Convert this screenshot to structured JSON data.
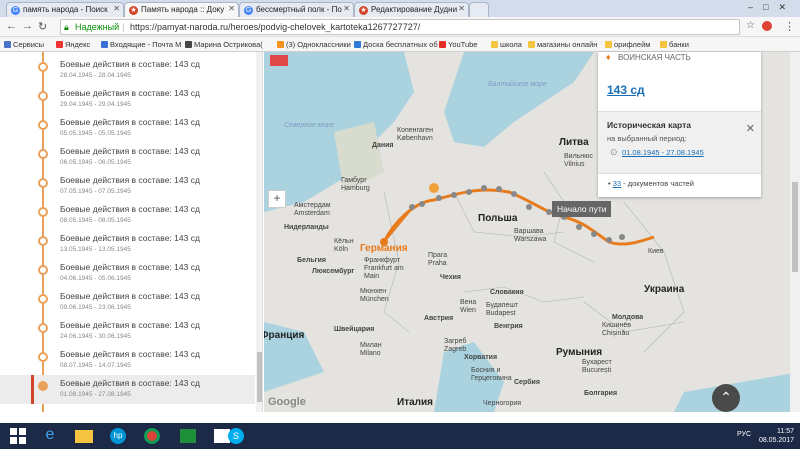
{
  "tabs": [
    {
      "label": "память народа - Поиск",
      "fav_color": "#4285f4",
      "fav_glyph": "G"
    },
    {
      "label": "Память народа :: Доку",
      "fav_color": "#d0442a",
      "fav_glyph": "★"
    },
    {
      "label": "бессмертный полк - По",
      "fav_color": "#4285f4",
      "fav_glyph": "G"
    },
    {
      "label": "Редактирование Дудни",
      "fav_color": "#d0442a",
      "fav_glyph": "★"
    }
  ],
  "address": {
    "secure_label": "Надежный",
    "url": "https://pamyat-naroda.ru/heroes/podvig-chelovek_kartoteka1267727727/"
  },
  "bookmarks": [
    "Сервисы",
    "Яндекс",
    "Входящие - Почта M",
    "Марина Острикова(",
    "(3) Одноклассники",
    "Доска бесплатных об",
    "YouTube",
    "школа",
    "магазины онлайн",
    "орифлейм",
    "банки"
  ],
  "events": [
    {
      "title": "Боевые действия в составе: 143 сд",
      "dates": "28.04.1945 - 28.04.1945"
    },
    {
      "title": "Боевые действия в составе: 143 сд",
      "dates": "29.04.1945 - 29.04.1945"
    },
    {
      "title": "Боевые действия в составе: 143 сд",
      "dates": "05.05.1945 - 05.05.1945"
    },
    {
      "title": "Боевые действия в составе: 143 сд",
      "dates": "06.05.1945 - 06.05.1945"
    },
    {
      "title": "Боевые действия в составе: 143 сд",
      "dates": "07.05.1945 - 07.05.1945"
    },
    {
      "title": "Боевые действия в составе: 143 сд",
      "dates": "08.05.1945 - 08.05.1945"
    },
    {
      "title": "Боевые действия в составе: 143 сд",
      "dates": "13.05.1945 - 13.05.1945"
    },
    {
      "title": "Боевые действия в составе: 143 сд",
      "dates": "04.06.1945 - 05.06.1945"
    },
    {
      "title": "Боевые действия в составе: 143 сд",
      "dates": "09.06.1945 - 23.06.1945"
    },
    {
      "title": "Боевые действия в составе: 143 сд",
      "dates": "24.06.1945 - 30.06.1945"
    },
    {
      "title": "Боевые действия в составе: 143 сд",
      "dates": "08.07.1945 - 14.07.1945"
    },
    {
      "title": "Боевые действия в составе: 143 сд",
      "dates": "01.08.1945 - 27.08.1945"
    }
  ],
  "infobox": {
    "unit_header": "ВОИНСКАЯ ЧАСТЬ",
    "unit_link": "143 сд",
    "hist_title": "Историческая карта",
    "hist_period": "на выбранный период:",
    "hist_dates": "01.08.1945 - 27.08.1945",
    "doc_count": "33",
    "doc_label": " - документов частей"
  },
  "tooltip": "Начало пути",
  "map_labels": {
    "baltic": "Балтийское море",
    "north_sea": "Северное море",
    "denmark": "Дания",
    "copenhagen": "Копенгаген København",
    "hamburg": "Гамбург Hamburg",
    "amsterdam": "Амстердам Amsterdam",
    "netherlands": "Нидерланды",
    "germany": "Германия",
    "belgium": "Бельгия",
    "luxembourg": "Люксембург",
    "frankfurt": "Франкфурт Frankfurt am Main",
    "cologne": "Кёльн Köln",
    "poland": "Польша",
    "warsaw": "Варшава Warszawa",
    "lithuania": "Литва",
    "vilnius": "Вильнюс Vilnius",
    "prague": "Прага Praha",
    "czechia": "Чехия",
    "slovakia": "Словакия",
    "vienna": "Вена Wien",
    "austria": "Австрия",
    "munich": "Мюнхен München",
    "switzerland": "Швейцария",
    "france": "Франция",
    "hungary": "Венгрия",
    "budapest": "Будапешт Budapest",
    "croatia": "Хорватия",
    "zagreb": "Загреб Zagreb",
    "romania": "Румыния",
    "bucharest": "Бухарест București",
    "moldova": "Молдова",
    "chisinau": "Кишинёв Chișinău",
    "ukraine": "Украина",
    "kyiv": "Киев",
    "serbia": "Сербия",
    "bosnia": "Босния и Герцеговина",
    "montenegro": "Черногория",
    "italy": "Италия",
    "milan": "Милан Milano",
    "bulgaria": "Болгария"
  },
  "google_logo": "Google",
  "taskbar": {
    "time": "11:57",
    "date": "08.05.2017",
    "lang": "РУС"
  }
}
